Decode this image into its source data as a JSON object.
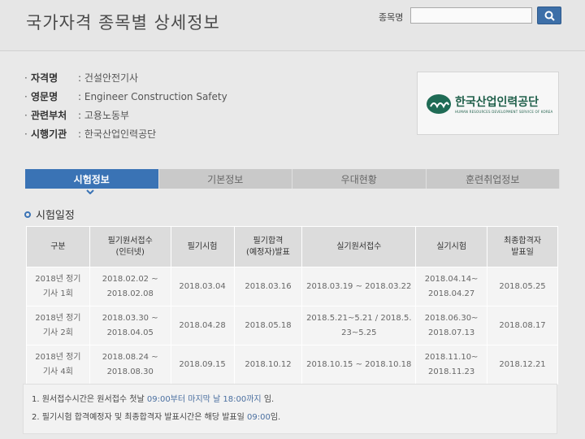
{
  "header": {
    "title": "국가자격 종목별 상세정보",
    "search_label": "종목명",
    "search_value": "",
    "search_icon": "search-icon"
  },
  "info": {
    "rows": [
      {
        "label": "자격명",
        "value": ": 건설안전기사"
      },
      {
        "label": "영문명",
        "value": ": Engineer Construction Safety"
      },
      {
        "label": "관련부처",
        "value": ": 고용노동부"
      },
      {
        "label": "시행기관",
        "value": ": 한국산업인력공단"
      }
    ]
  },
  "logo": {
    "name": "한국산업인력공단",
    "subtitle": "HUMAN RESOURCES DEVELOPMENT SERVICE OF KOREA"
  },
  "tabs": [
    "시험정보",
    "기본정보",
    "우대현황",
    "훈련취업정보"
  ],
  "active_tab": 0,
  "section_title": "시험일정",
  "table": {
    "headers": [
      "구분",
      "필기원서접수\n(인터넷)",
      "필기시험",
      "필기합격\n(예정자)발표",
      "실기원서접수",
      "실기시험",
      "최종합격자\n발표일"
    ],
    "rows": [
      [
        "2018년 정기\n기사 1회",
        "2018.02.02 ~\n2018.02.08",
        "2018.03.04",
        "2018.03.16",
        "2018.03.19 ~ 2018.03.22",
        "2018.04.14~\n2018.04.27",
        "2018.05.25"
      ],
      [
        "2018년 정기\n기사 2회",
        "2018.03.30 ~\n2018.04.05",
        "2018.04.28",
        "2018.05.18",
        "2018.5.21~5.21 / 2018.5.\n23~5.25",
        "2018.06.30~\n2018.07.13",
        "2018.08.17"
      ],
      [
        "2018년 정기\n기사 4회",
        "2018.08.24 ~\n2018.08.30",
        "2018.09.15",
        "2018.10.12",
        "2018.10.15 ~ 2018.10.18",
        "2018.11.10~\n2018.11.23",
        "2018.12.21"
      ]
    ]
  },
  "notes": [
    {
      "pre": "1. 원서접수시간은 원서접수 첫날 ",
      "hl": "09:00부터 마지막 날 18:00까지",
      "post": " 임."
    },
    {
      "pre": "2. 필기시험 합격예정자 및 최종합격자 발표시간은 해당 발표일 ",
      "hl": "09:00",
      "post": "임."
    }
  ],
  "colors": {
    "accent": "#3a73b5",
    "tab_inactive": "#c9c9c9",
    "logo_green": "#1f5f4a"
  }
}
